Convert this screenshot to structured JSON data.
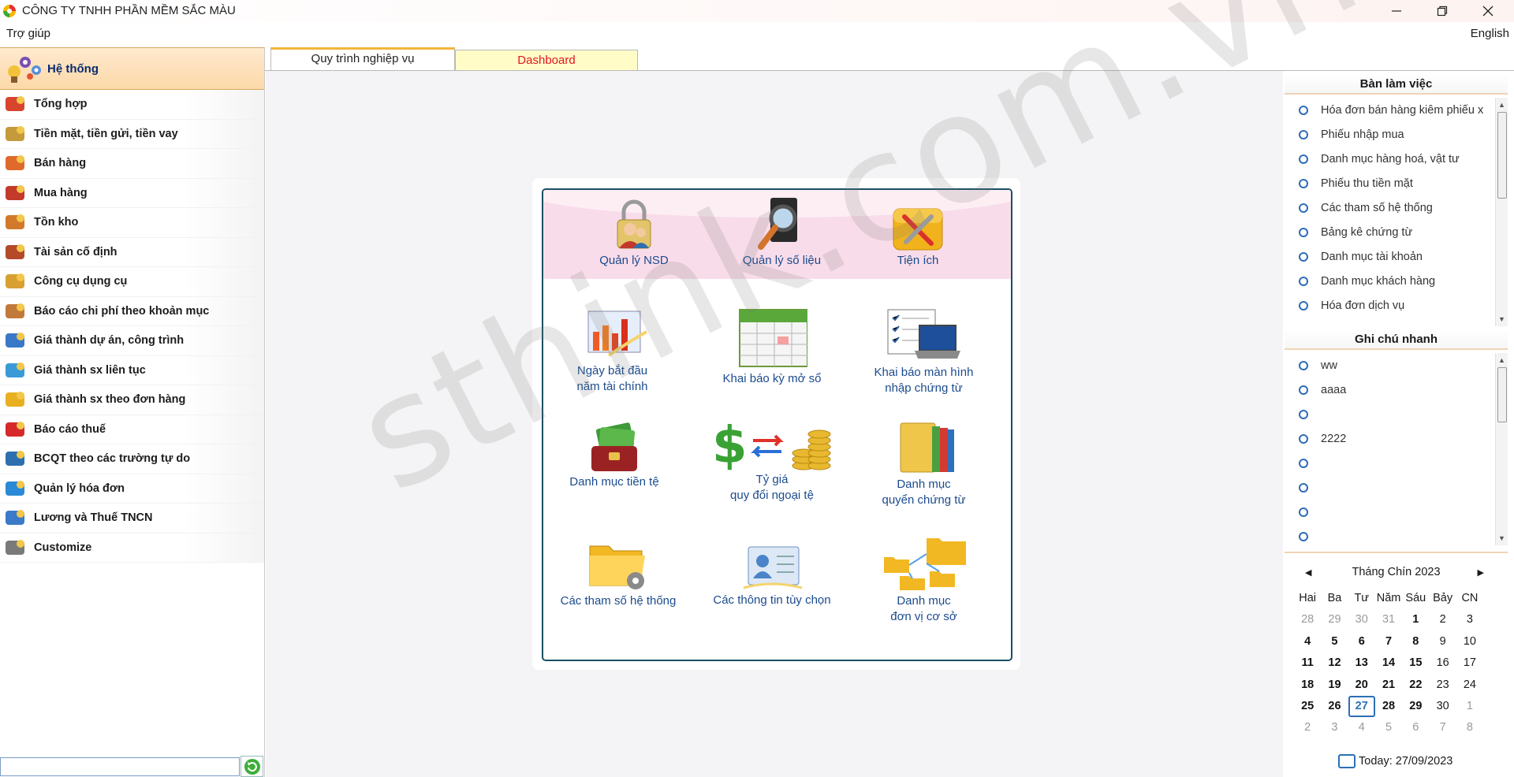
{
  "window": {
    "title": "CÔNG TY TNHH PHẦN MỀM SẮC MÀU"
  },
  "menubar": {
    "help": "Trợ giúp",
    "language": "English"
  },
  "sidebar": {
    "header": "Hệ thống",
    "items": [
      {
        "label": "Tổng hợp",
        "icon": "summary-icon"
      },
      {
        "label": "Tiền mặt, tiền gửi, tiền vay",
        "icon": "scale-icon"
      },
      {
        "label": "Bán hàng",
        "icon": "sales-icon"
      },
      {
        "label": "Mua hàng",
        "icon": "cart-icon"
      },
      {
        "label": "Tồn kho",
        "icon": "warehouse-icon"
      },
      {
        "label": "Tài sản cố định",
        "icon": "assets-icon"
      },
      {
        "label": "Công cụ dụng cụ",
        "icon": "tools-box-icon"
      },
      {
        "label": "Báo cáo chi phí theo khoản mục",
        "icon": "cost-report-icon"
      },
      {
        "label": "Giá thành dự án, công trình",
        "icon": "bar-chart-icon"
      },
      {
        "label": "Giá thành sx liên tục",
        "icon": "molecule-icon"
      },
      {
        "label": "Giá thành sx theo đơn hàng",
        "icon": "folder-icon"
      },
      {
        "label": "Báo cáo thuế",
        "icon": "tax-icon"
      },
      {
        "label": "BCQT theo các trường tự do",
        "icon": "book-icon"
      },
      {
        "label": "Quản lý hóa đơn",
        "icon": "monitor-icon"
      },
      {
        "label": "Lương và Thuế TNCN",
        "icon": "salary-icon"
      },
      {
        "label": "Customize",
        "icon": "wrench-icon"
      }
    ],
    "search_value": ""
  },
  "tabs": [
    {
      "label": "Quy trình nghiệp vụ",
      "active": true
    },
    {
      "label": "Dashboard",
      "active": false
    }
  ],
  "workflow": {
    "top": [
      {
        "label": "Quản lý NSD",
        "icon": "user-lock-icon"
      },
      {
        "label": "Quản lý số liệu",
        "icon": "magnifier-book-icon"
      },
      {
        "label": "Tiện ích",
        "icon": "toolbox-icon"
      }
    ],
    "row1": [
      {
        "line1": "Ngày bắt đầu",
        "line2": "năm tài chính",
        "icon": "fiscal-chart-icon"
      },
      {
        "line1": "Khai báo kỳ mở sổ",
        "line2": "",
        "icon": "calendar-icon"
      },
      {
        "line1": "Khai báo màn hình",
        "line2": "nhập chứng từ",
        "icon": "laptop-checklist-icon"
      }
    ],
    "row2": [
      {
        "line1": "Danh mục tiền tệ",
        "line2": "",
        "icon": "wallet-money-icon"
      },
      {
        "line1": "Tỷ giá",
        "line2": "quy đổi ngoại tệ",
        "icon": "exchange-rate-icon"
      },
      {
        "line1": "Danh mục",
        "line2": "quyển chứng từ",
        "icon": "binders-icon"
      }
    ],
    "row3": [
      {
        "line1": "Các tham số hệ thống",
        "line2": "",
        "icon": "folder-gear-icon"
      },
      {
        "line1": "Các thông tin tùy chọn",
        "line2": "",
        "icon": "profile-card-icon"
      },
      {
        "line1": "Danh mục",
        "line2": "đơn vị cơ sở",
        "icon": "folder-tree-icon"
      }
    ]
  },
  "watermark": "sthink.com.vn",
  "desk": {
    "title": "Bàn làm việc",
    "items": [
      "Hóa đơn bán hàng kiêm phiếu x",
      "Phiếu nhập mua",
      "Danh mục hàng hoá, vật tư",
      "Phiếu thu tiền mặt",
      "Các tham số hệ thống",
      "Bảng kê chứng từ",
      "Danh mục tài khoản",
      "Danh mục khách hàng",
      "Hóa đơn dịch vụ"
    ]
  },
  "notes": {
    "title": "Ghi chú nhanh",
    "items": [
      "ww",
      "aaaa",
      "",
      "2222",
      "",
      "",
      "",
      ""
    ]
  },
  "calendar": {
    "month_label": "Tháng Chín 2023",
    "weekdays": [
      "Hai",
      "Ba",
      "Tư",
      "Năm",
      "Sáu",
      "Bảy",
      "CN"
    ],
    "weeks": [
      [
        {
          "d": "28",
          "t": "dim"
        },
        {
          "d": "29",
          "t": "dim"
        },
        {
          "d": "30",
          "t": "dim"
        },
        {
          "d": "31",
          "t": "dim"
        },
        {
          "d": "1",
          "t": "bold"
        },
        {
          "d": "2",
          "t": ""
        },
        {
          "d": "3",
          "t": ""
        }
      ],
      [
        {
          "d": "4",
          "t": "bold"
        },
        {
          "d": "5",
          "t": "bold"
        },
        {
          "d": "6",
          "t": "bold"
        },
        {
          "d": "7",
          "t": "bold"
        },
        {
          "d": "8",
          "t": "bold"
        },
        {
          "d": "9",
          "t": ""
        },
        {
          "d": "10",
          "t": ""
        }
      ],
      [
        {
          "d": "11",
          "t": "bold"
        },
        {
          "d": "12",
          "t": "bold"
        },
        {
          "d": "13",
          "t": "bold"
        },
        {
          "d": "14",
          "t": "bold"
        },
        {
          "d": "15",
          "t": "bold"
        },
        {
          "d": "16",
          "t": ""
        },
        {
          "d": "17",
          "t": ""
        }
      ],
      [
        {
          "d": "18",
          "t": "bold"
        },
        {
          "d": "19",
          "t": "bold"
        },
        {
          "d": "20",
          "t": "bold"
        },
        {
          "d": "21",
          "t": "bold"
        },
        {
          "d": "22",
          "t": "bold"
        },
        {
          "d": "23",
          "t": ""
        },
        {
          "d": "24",
          "t": ""
        }
      ],
      [
        {
          "d": "25",
          "t": "bold"
        },
        {
          "d": "26",
          "t": "bold"
        },
        {
          "d": "27",
          "t": "today"
        },
        {
          "d": "28",
          "t": "bold"
        },
        {
          "d": "29",
          "t": "bold"
        },
        {
          "d": "30",
          "t": ""
        },
        {
          "d": "1",
          "t": "dim"
        }
      ],
      [
        {
          "d": "2",
          "t": "dim"
        },
        {
          "d": "3",
          "t": "dim"
        },
        {
          "d": "4",
          "t": "dim"
        },
        {
          "d": "5",
          "t": "dim"
        },
        {
          "d": "6",
          "t": "dim"
        },
        {
          "d": "7",
          "t": "dim"
        },
        {
          "d": "8",
          "t": "dim"
        }
      ]
    ],
    "today_label": "Today: 27/09/2023"
  }
}
